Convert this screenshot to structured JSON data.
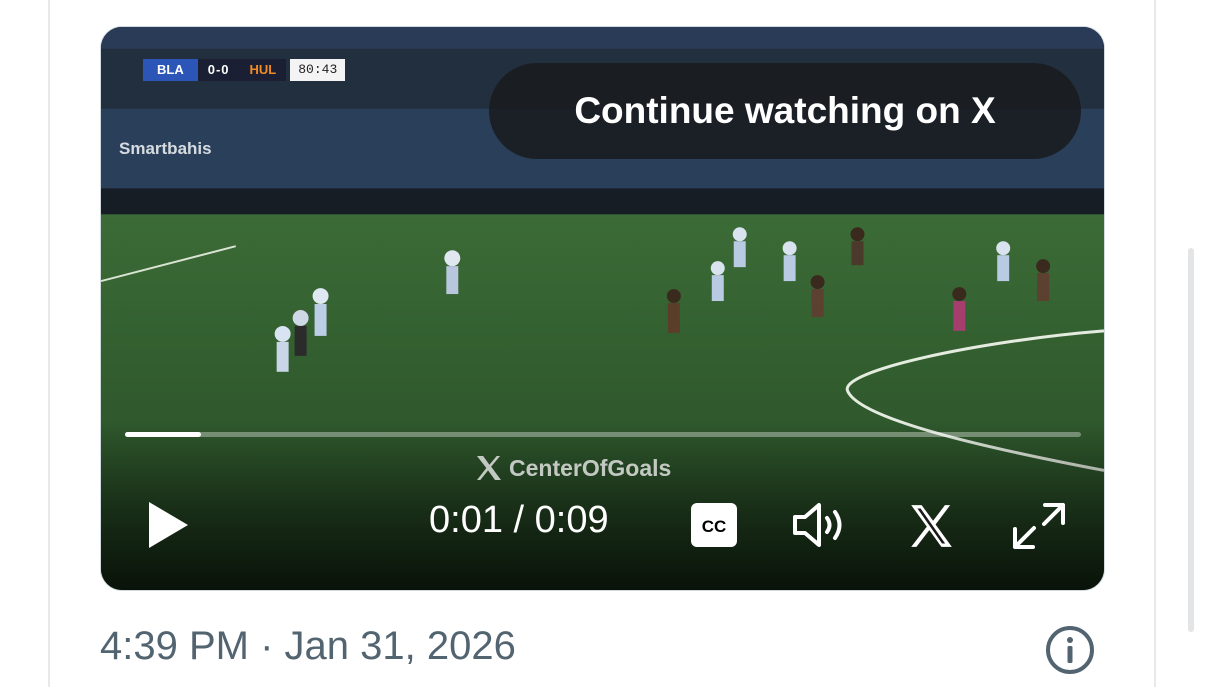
{
  "video": {
    "scorebug": {
      "home_team": "BLA",
      "score": "0-0",
      "away_team": "HUL",
      "clock": "80:43"
    },
    "sponsor": "Smartbahis",
    "overlay_prompt": "Continue watching on X",
    "watermark": "CenterOfGoals",
    "progress": 0.08,
    "time_display": "0:01 / 0:09",
    "controls": {
      "play_icon": "play-icon",
      "cc_label": "CC",
      "volume_icon": "volume-icon",
      "x_icon": "x-logo-icon",
      "fullscreen_icon": "fullscreen-icon"
    }
  },
  "post": {
    "timestamp": "4:39 PM · Jan 31, 2026",
    "info_icon": "info-icon"
  },
  "colors": {
    "pitch": "#2e5a2f",
    "scorebug_home": "#2b56b8",
    "scorebug_away_text": "#f28a25",
    "timestamp_text": "#536471"
  }
}
